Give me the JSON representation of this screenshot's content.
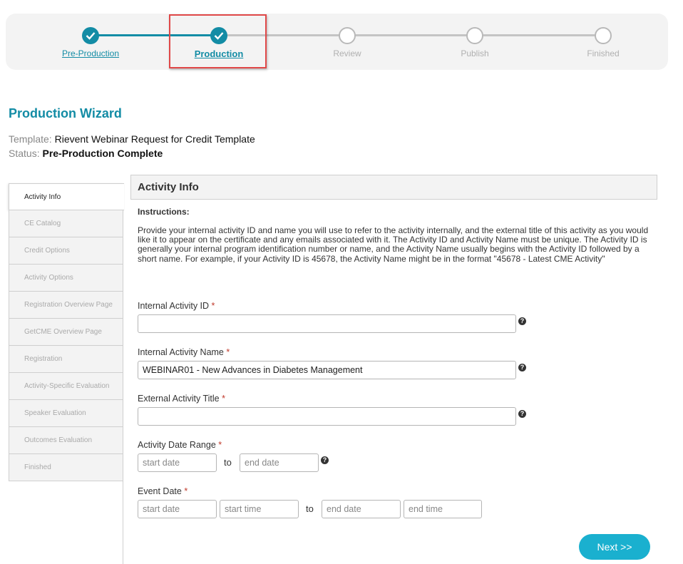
{
  "stepper": {
    "steps": [
      {
        "label": "Pre-Production",
        "state": "done"
      },
      {
        "label": "Production",
        "state": "current"
      },
      {
        "label": "Review",
        "state": "todo"
      },
      {
        "label": "Publish",
        "state": "todo"
      },
      {
        "label": "Finished",
        "state": "todo"
      }
    ],
    "check_icon": "check-icon"
  },
  "header": {
    "title": "Production Wizard",
    "template_key": "Template:",
    "template_value": "Rievent Webinar Request for Credit Template",
    "status_key": "Status:",
    "status_value": "Pre-Production Complete"
  },
  "tabs": [
    {
      "label": "Activity Info",
      "active": true
    },
    {
      "label": "CE Catalog"
    },
    {
      "label": "Credit Options"
    },
    {
      "label": "Activity Options"
    },
    {
      "label": "Registration Overview Page"
    },
    {
      "label": "GetCME Overview Page"
    },
    {
      "label": "Registration"
    },
    {
      "label": "Activity-Specific Evaluation"
    },
    {
      "label": "Speaker Evaluation"
    },
    {
      "label": "Outcomes Evaluation"
    },
    {
      "label": "Finished"
    }
  ],
  "panel": {
    "title": "Activity Info",
    "instructions_title": "Instructions:",
    "instructions_text": "Provide your internal activity ID and name you will use to refer to the activity internally, and the external title of this activity as you would like it to appear on the certificate and any emails associated with it. The Activity ID and Activity Name must be unique. The Activity ID is generally your internal program identification number or name, and the Activity Name usually begins with the Activity ID followed by a short name. For example, if your Activity ID is 45678, the Activity Name might be in the format \"45678 - Latest CME Activity\"",
    "required_mark": "*",
    "fields": {
      "internal_id": {
        "label": "Internal Activity ID",
        "value": ""
      },
      "internal_name": {
        "label": "Internal Activity Name",
        "value": "WEBINAR01 - New Advances in Diabetes Management"
      },
      "external_title": {
        "label": "External Activity Title",
        "value": ""
      },
      "date_range": {
        "label": "Activity Date Range",
        "start_placeholder": "start date",
        "end_placeholder": "end date",
        "to": "to"
      },
      "event_date": {
        "label": "Event Date",
        "start_date_placeholder": "start date",
        "start_time_placeholder": "start time",
        "end_date_placeholder": "end date",
        "end_time_placeholder": "end time",
        "to": "to"
      }
    },
    "help_glyph": "?",
    "next_label": "Next >>"
  },
  "colors": {
    "accent": "#138ca5",
    "button": "#1ab0cf",
    "highlight": "#e04848"
  }
}
